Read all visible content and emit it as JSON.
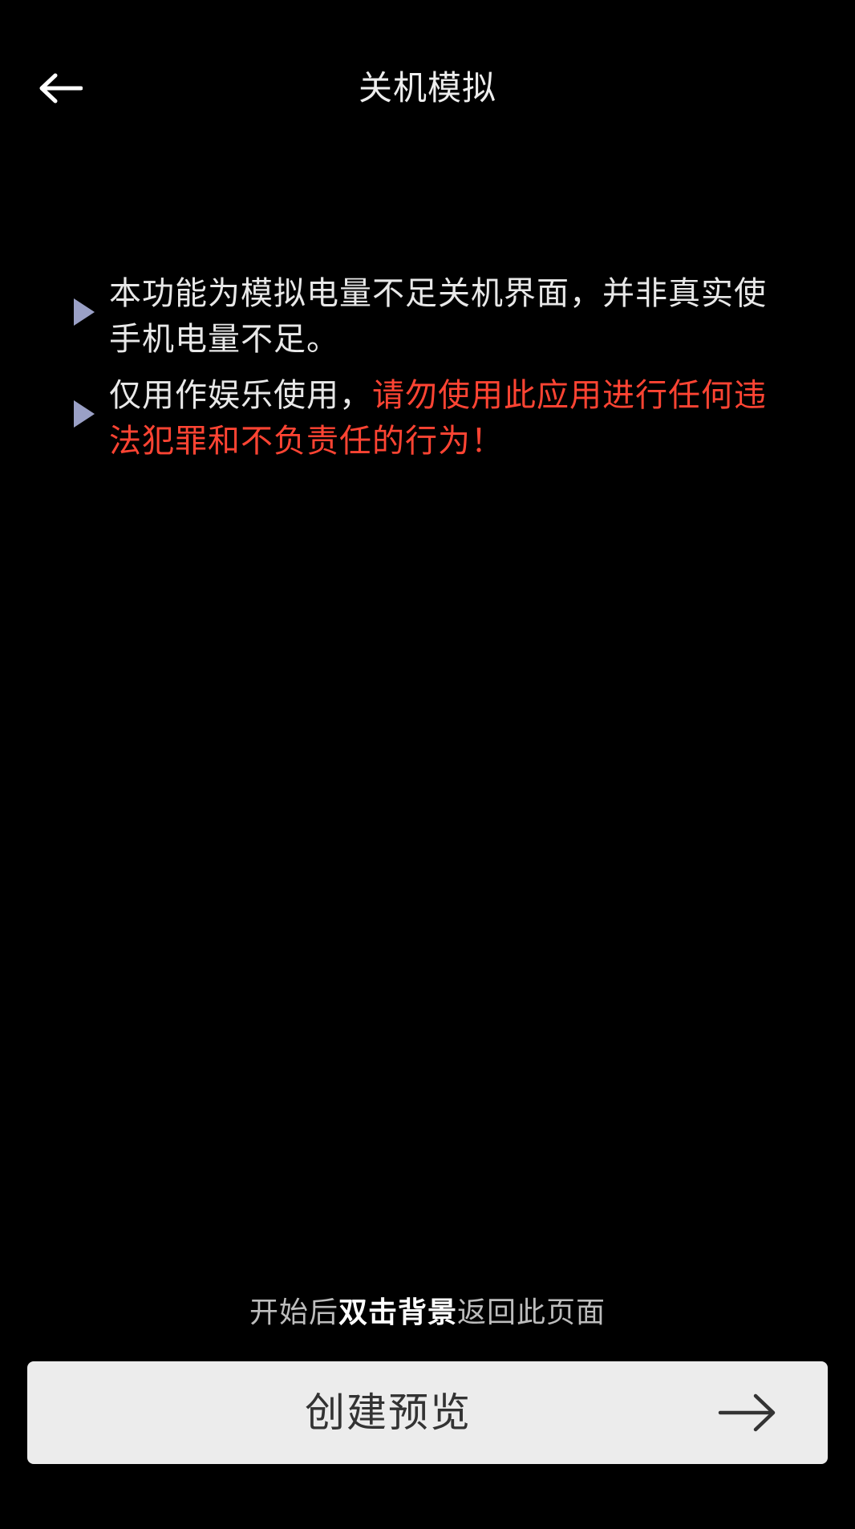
{
  "header": {
    "title": "关机模拟",
    "back_icon": "arrow-left-icon"
  },
  "notices": [
    {
      "text": "本功能为模拟电量不足关机界面，并非真实使手机电量不足。",
      "warning": ""
    },
    {
      "text": "仅用作娱乐使用，",
      "warning": "请勿使用此应用进行任何违法犯罪和不负责任的行为！"
    }
  ],
  "hint": {
    "prefix": "开始后",
    "emphasis": "双击背景",
    "suffix": "返回此页面"
  },
  "create_button": {
    "label": "创建预览",
    "icon": "arrow-right-icon"
  },
  "colors": {
    "background": "#000000",
    "text": "#e8e8e8",
    "warning": "#ff4433",
    "bullet": "#9aa0c6",
    "button_bg": "#ececec"
  }
}
